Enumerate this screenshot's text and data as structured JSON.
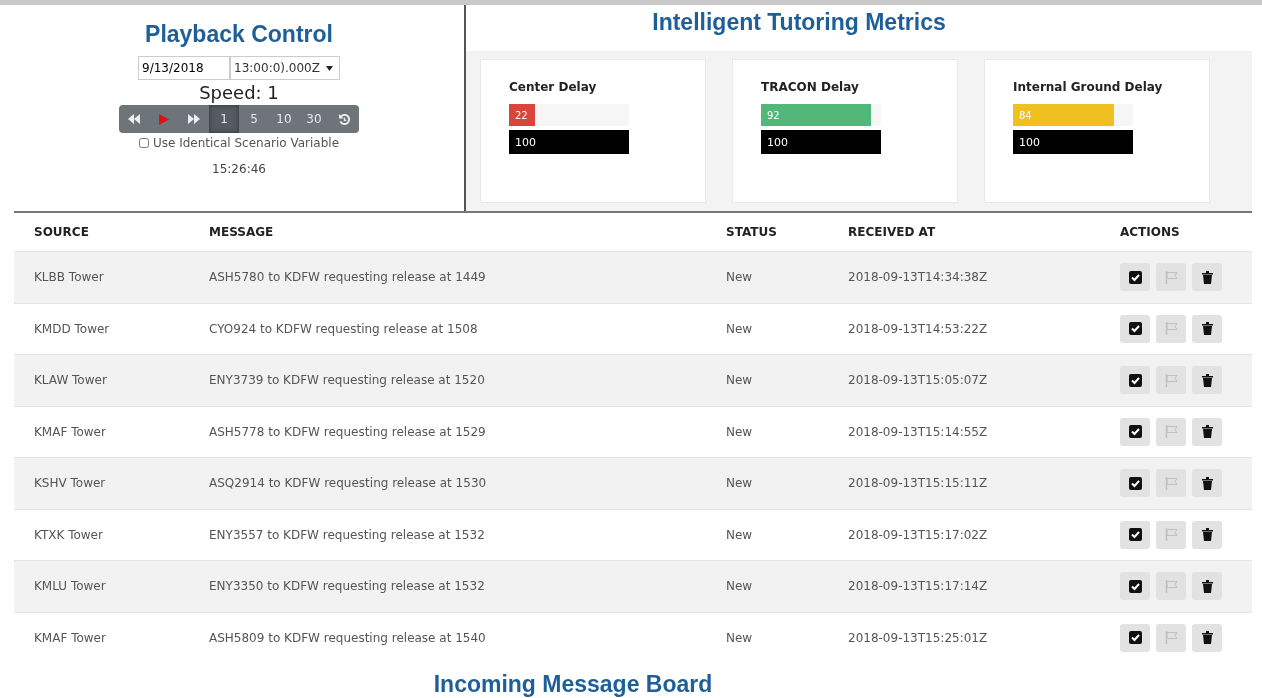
{
  "playback": {
    "title": "Playback Control",
    "date": "9/13/2018",
    "time": "13:00:0).000Z",
    "speed_label": "Speed: 1",
    "controls": [
      {
        "kind": "rewind",
        "selected": false
      },
      {
        "kind": "play",
        "selected": false
      },
      {
        "kind": "forward",
        "selected": false
      }
    ],
    "speeds": [
      {
        "label": "1",
        "selected": true
      },
      {
        "label": "5",
        "selected": false
      },
      {
        "label": "10",
        "selected": false
      },
      {
        "label": "30",
        "selected": false
      }
    ],
    "reset": {
      "kind": "reset"
    },
    "option": {
      "label": "Use Identical Scenario Variable",
      "checked": false
    },
    "clock": "15:26:46"
  },
  "metrics": {
    "title": "Intelligent Tutoring Metrics",
    "cards": [
      {
        "title": "Center Delay",
        "value": "22",
        "level": 0.22,
        "color": "#d9453c",
        "limit": "100"
      },
      {
        "title": "TRACON Delay",
        "value": "92",
        "level": 0.92,
        "color": "#52b879",
        "limit": "100"
      },
      {
        "title": "Internal Ground Delay",
        "value": "84",
        "level": 0.84,
        "color": "#f0c020",
        "limit": "100"
      }
    ]
  },
  "table": {
    "columns": [
      "SOURCE",
      "MESSAGE",
      "STATUS",
      "RECEIVED AT",
      "ACTIONS"
    ],
    "actions": [
      {
        "kind": "check",
        "disabled": false
      },
      {
        "kind": "flag",
        "disabled": true
      },
      {
        "kind": "trash",
        "disabled": false
      }
    ],
    "rows": [
      {
        "source": "KLBB Tower",
        "message": "ASH5780 to KDFW requesting release at 1449",
        "status": "New",
        "received": "2018-09-13T14:34:38Z"
      },
      {
        "source": "KMDD Tower",
        "message": "CYO924 to KDFW requesting release at 1508",
        "status": "New",
        "received": "2018-09-13T14:53:22Z"
      },
      {
        "source": "KLAW Tower",
        "message": "ENY3739 to KDFW requesting release at 1520",
        "status": "New",
        "received": "2018-09-13T15:05:07Z"
      },
      {
        "source": "KMAF Tower",
        "message": "ASH5778 to KDFW requesting release at 1529",
        "status": "New",
        "received": "2018-09-13T15:14:55Z"
      },
      {
        "source": "KSHV Tower",
        "message": "ASQ2914 to KDFW requesting release at 1530",
        "status": "New",
        "received": "2018-09-13T15:15:11Z"
      },
      {
        "source": "KTXK Tower",
        "message": "ENY3557 to KDFW requesting release at 1532",
        "status": "New",
        "received": "2018-09-13T15:17:02Z"
      },
      {
        "source": "KMLU Tower",
        "message": "ENY3350 to KDFW requesting release at 1532",
        "status": "New",
        "received": "2018-09-13T15:17:14Z"
      },
      {
        "source": "KMAF Tower",
        "message": "ASH5809 to KDFW requesting release at 1540",
        "status": "New",
        "received": "2018-09-13T15:25:01Z"
      }
    ]
  },
  "footer": {
    "title": "Incoming Message Board"
  }
}
